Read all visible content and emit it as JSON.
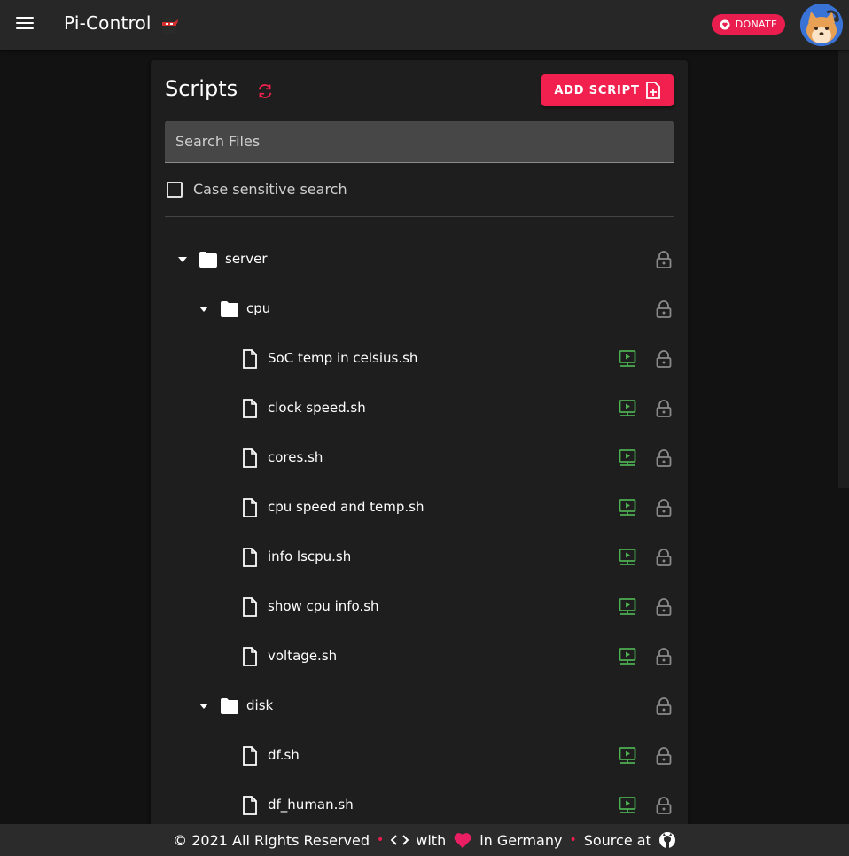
{
  "app": {
    "title": "Pi-Control",
    "donate_label": "DONATE"
  },
  "card": {
    "title": "Scripts",
    "add_button_label": "ADD SCRIPT",
    "search_placeholder": "Search Files",
    "case_sensitive_label": "Case sensitive search"
  },
  "colors": {
    "accent": "#f1204f",
    "run_icon": "#4caf50",
    "lock_icon": "#8a8a8a"
  },
  "tree": [
    {
      "type": "folder",
      "depth": 0,
      "name": "server"
    },
    {
      "type": "folder",
      "depth": 1,
      "name": "cpu"
    },
    {
      "type": "file",
      "depth": 2,
      "name": "SoC temp in celsius.sh"
    },
    {
      "type": "file",
      "depth": 2,
      "name": "clock speed.sh"
    },
    {
      "type": "file",
      "depth": 2,
      "name": "cores.sh"
    },
    {
      "type": "file",
      "depth": 2,
      "name": "cpu speed and temp.sh"
    },
    {
      "type": "file",
      "depth": 2,
      "name": "info lscpu.sh"
    },
    {
      "type": "file",
      "depth": 2,
      "name": "show cpu info.sh"
    },
    {
      "type": "file",
      "depth": 2,
      "name": "voltage.sh"
    },
    {
      "type": "folder",
      "depth": 1,
      "name": "disk"
    },
    {
      "type": "file",
      "depth": 2,
      "name": "df.sh"
    },
    {
      "type": "file",
      "depth": 2,
      "name": "df_human.sh"
    }
  ],
  "footer": {
    "copyright": "© 2021 All Rights Reserved",
    "with": "with",
    "location": "in Germany",
    "source": "Source at"
  }
}
